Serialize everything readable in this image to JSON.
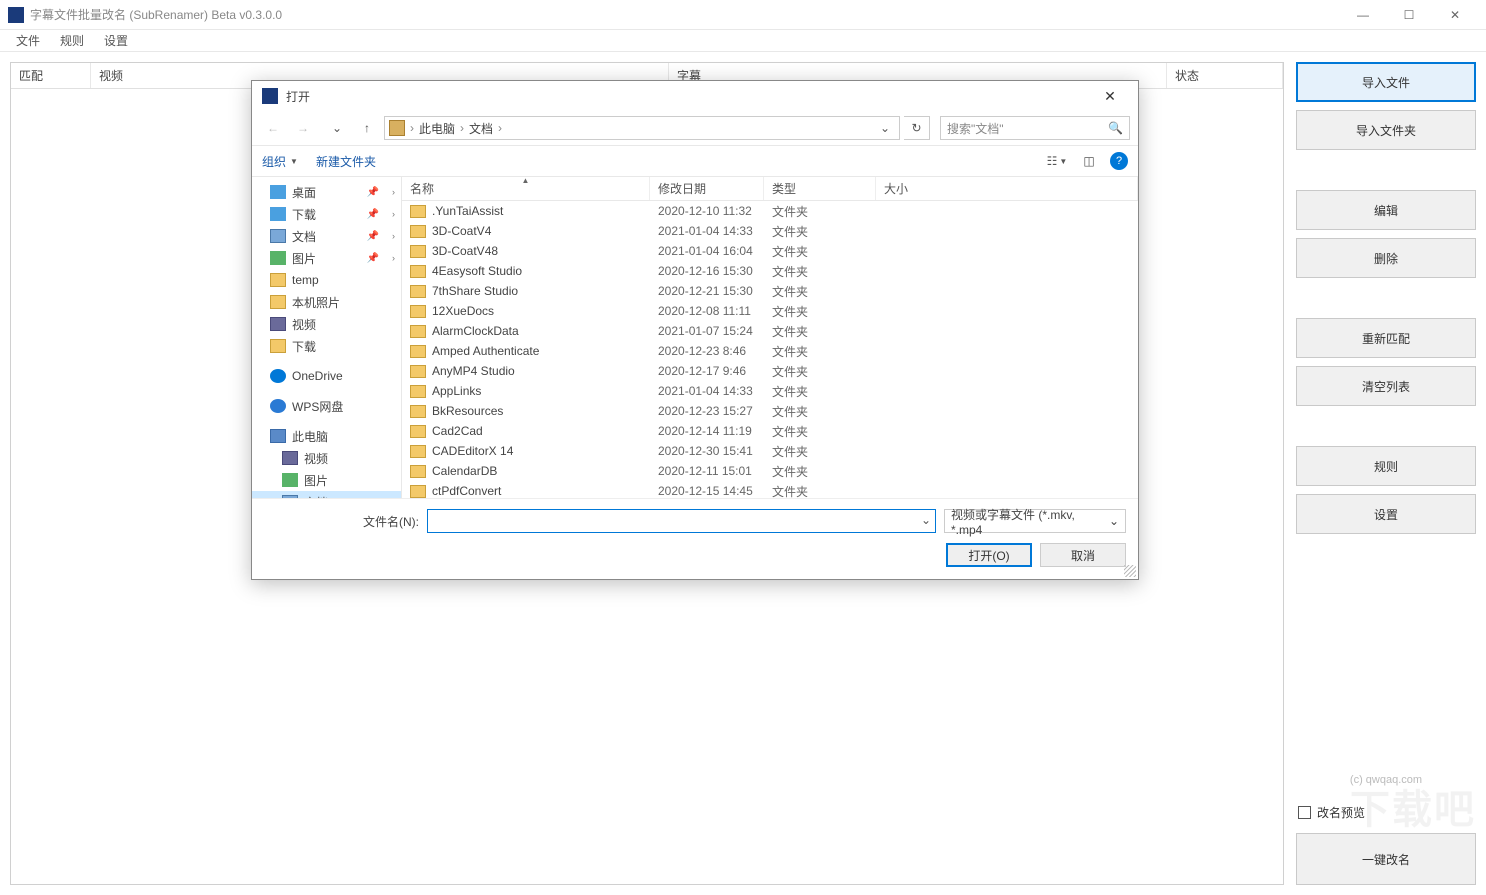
{
  "window": {
    "title": "字幕文件批量改名 (SubRenamer) Beta v0.3.0.0",
    "min": "—",
    "max": "☐",
    "close": "✕"
  },
  "menu": {
    "file": "文件",
    "rules": "规则",
    "settings": "设置"
  },
  "columns": {
    "match": "匹配",
    "video": "视频",
    "sub": "字幕",
    "status": "状态"
  },
  "side": {
    "import_file": "导入文件",
    "import_folder": "导入文件夹",
    "edit": "编辑",
    "delete": "删除",
    "rematch": "重新匹配",
    "clear": "清空列表",
    "rules": "规则",
    "settings": "设置",
    "credit": "(c) qwqaq.com",
    "preview": "改名预览",
    "run": "一键改名"
  },
  "dialog": {
    "title": "打开",
    "nav": {
      "back": "←",
      "fwd": "→",
      "up": "↑",
      "crumb_pc": "此电脑",
      "crumb_doc": "文档",
      "sep": "›",
      "search_placeholder": "搜索\"文档\"",
      "refresh": "↻",
      "dropdown": "⌄"
    },
    "toolbar": {
      "organize": "组织",
      "new_folder": "新建文件夹",
      "view": "☷",
      "preview": "◫",
      "help": "?"
    },
    "list_head": {
      "name": "名称",
      "date": "修改日期",
      "type": "类型",
      "size": "大小"
    },
    "rows": [
      {
        "name": ".YunTaiAssist",
        "date": "2020-12-10 11:32",
        "type": "文件夹"
      },
      {
        "name": "3D-CoatV4",
        "date": "2021-01-04 14:33",
        "type": "文件夹"
      },
      {
        "name": "3D-CoatV48",
        "date": "2021-01-04 16:04",
        "type": "文件夹"
      },
      {
        "name": "4Easysoft Studio",
        "date": "2020-12-16 15:30",
        "type": "文件夹"
      },
      {
        "name": "7thShare Studio",
        "date": "2020-12-21 15:30",
        "type": "文件夹"
      },
      {
        "name": "12XueDocs",
        "date": "2020-12-08 11:11",
        "type": "文件夹"
      },
      {
        "name": "AlarmClockData",
        "date": "2021-01-07 15:24",
        "type": "文件夹"
      },
      {
        "name": "Amped Authenticate",
        "date": "2020-12-23 8:46",
        "type": "文件夹"
      },
      {
        "name": "AnyMP4 Studio",
        "date": "2020-12-17 9:46",
        "type": "文件夹"
      },
      {
        "name": "AppLinks",
        "date": "2021-01-04 14:33",
        "type": "文件夹"
      },
      {
        "name": "BkResources",
        "date": "2020-12-23 15:27",
        "type": "文件夹"
      },
      {
        "name": "Cad2Cad",
        "date": "2020-12-14 11:19",
        "type": "文件夹"
      },
      {
        "name": "CADEditorX 14",
        "date": "2020-12-30 15:41",
        "type": "文件夹"
      },
      {
        "name": "CalendarDB",
        "date": "2020-12-11 15:01",
        "type": "文件夹"
      },
      {
        "name": "ctPdfConvert",
        "date": "2020-12-15 14:45",
        "type": "文件夹"
      }
    ],
    "tree": [
      {
        "label": "桌面",
        "icon": "i-desktop",
        "pin": true,
        "chev": true
      },
      {
        "label": "下载",
        "icon": "i-download",
        "pin": true,
        "chev": true
      },
      {
        "label": "文档",
        "icon": "i-doc",
        "pin": true,
        "chev": true
      },
      {
        "label": "图片",
        "icon": "i-pic",
        "pin": true,
        "chev": true
      },
      {
        "label": "temp",
        "icon": "i-folder"
      },
      {
        "label": "本机照片",
        "icon": "i-folder"
      },
      {
        "label": "视频",
        "icon": "i-vid"
      },
      {
        "label": "下载",
        "icon": "i-folder"
      },
      {
        "spacer": true
      },
      {
        "label": "OneDrive",
        "icon": "i-cloud"
      },
      {
        "spacer": true
      },
      {
        "label": "WPS网盘",
        "icon": "i-wps"
      },
      {
        "spacer": true
      },
      {
        "label": "此电脑",
        "icon": "i-pc"
      },
      {
        "label": "视频",
        "icon": "i-vid",
        "l2": true
      },
      {
        "label": "图片",
        "icon": "i-pic",
        "l2": true
      },
      {
        "label": "文档",
        "icon": "i-doc",
        "l2": true,
        "selected": true
      }
    ],
    "foot": {
      "fn_label": "文件名(N):",
      "filter": "视频或字幕文件 (*.mkv, *.mp4",
      "open": "打开(O)",
      "cancel": "取消"
    }
  },
  "watermark": "下载吧"
}
